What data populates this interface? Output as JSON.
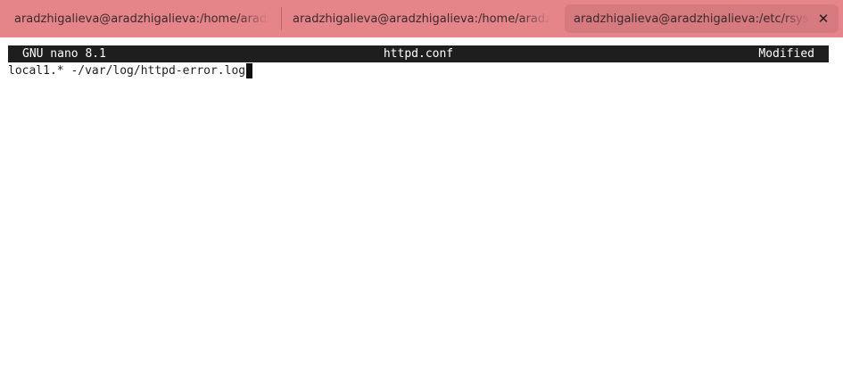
{
  "tabs": [
    {
      "title": "aradzhigalieva@aradzhigalieva:/home/aradzhigalieva",
      "active": false
    },
    {
      "title": "aradzhigalieva@aradzhigalieva:/home/aradzhigalieva",
      "active": false
    },
    {
      "title": "aradzhigalieva@aradzhigalieva:/etc/rsyslog.d",
      "active": true,
      "close_icon": "close-icon"
    }
  ],
  "nano": {
    "version": "GNU nano 8.1",
    "filename": "httpd.conf",
    "status": "Modified"
  },
  "editor": {
    "lines": [
      "local1.* -/var/log/httpd-error.log"
    ]
  },
  "colors": {
    "tabbar": "#e5858a",
    "active_tab": "#d77a80",
    "titlebar_bg": "#1e1e1e",
    "background": "#ffffff"
  }
}
